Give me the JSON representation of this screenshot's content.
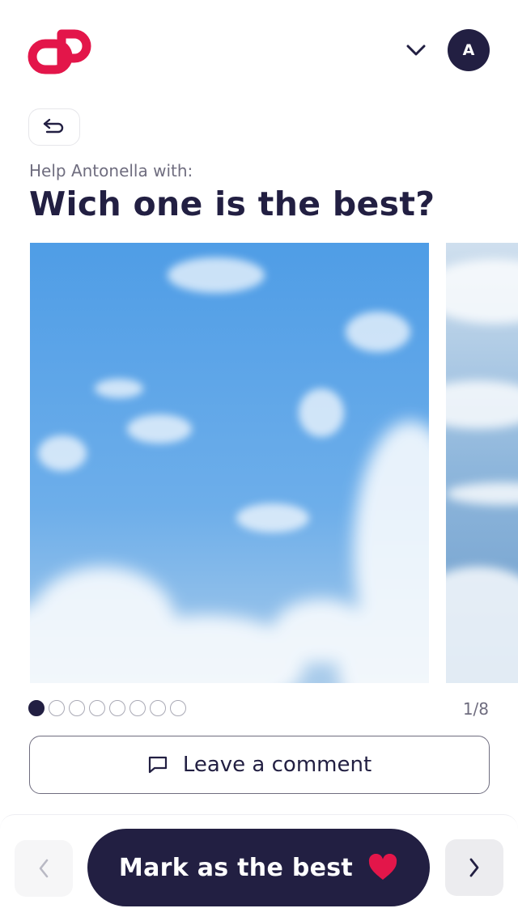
{
  "header": {
    "logo": "brand-logo",
    "avatar_initial": "A",
    "dropdown_icon": "chevron-down-icon"
  },
  "back_button": {
    "icon": "undo-arrow-icon"
  },
  "question": {
    "subtitle": "Help Antonella with:",
    "title": "Wich one is the best?"
  },
  "carousel": {
    "slides": [
      {
        "image": "blue-sky-clouds-photo"
      },
      {
        "image": "clouds-from-above-photo"
      }
    ],
    "total": 8,
    "current": 1,
    "counter": "1/8"
  },
  "comment_button": {
    "label": "Leave a comment",
    "icon": "comment-icon"
  },
  "bottom_bar": {
    "primary_label": "Mark as the best",
    "heart_icon": "heart-icon",
    "prev_icon": "chevron-left-icon",
    "next_icon": "chevron-right-icon"
  },
  "colors": {
    "brand": "#e3164a",
    "primary": "#221f42",
    "muted_text": "#6f6d7f"
  }
}
